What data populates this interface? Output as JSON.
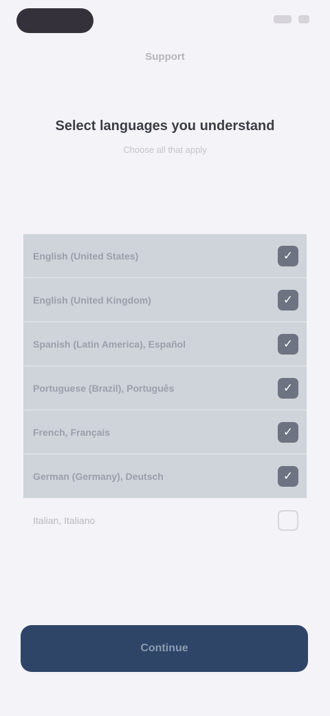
{
  "nav": {
    "title": "Support"
  },
  "header": {
    "title": "Select languages you understand",
    "subtitle": "Choose all that apply"
  },
  "languages": [
    {
      "label": "English (United States)",
      "checked": true
    },
    {
      "label": "English (United Kingdom)",
      "checked": true
    },
    {
      "label": "Spanish (Latin America), Español",
      "checked": true
    },
    {
      "label": "Portuguese (Brazil), Português",
      "checked": true
    },
    {
      "label": "French, Français",
      "checked": true
    },
    {
      "label": "German (Germany), Deutsch",
      "checked": true
    },
    {
      "label": "Italian, Italiano",
      "checked": false
    }
  ],
  "footer": {
    "button_label": "Continue"
  },
  "colors": {
    "accent": "#2e4567",
    "checked_row": "#cfd3da",
    "checkbox": "#6d7380"
  },
  "icons": {
    "checked": "checkmark-icon"
  }
}
